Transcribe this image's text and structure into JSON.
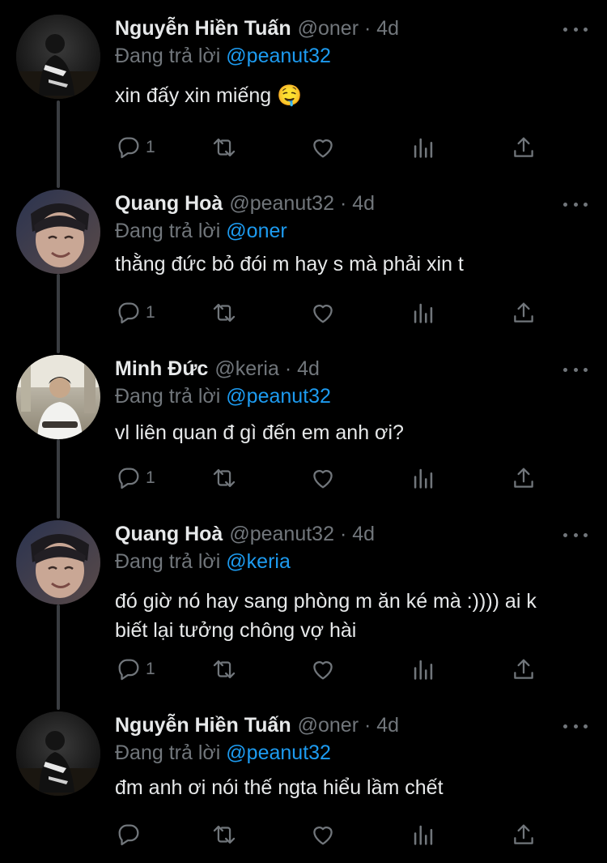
{
  "tweets": [
    {
      "name": "Nguyễn Hiền Tuấn",
      "meta": "@oner · 4d",
      "replying_prefix": "Đang trả lời",
      "replying_to": "@peanut32",
      "text": "xin đấy xin miếng 🤤",
      "reply_count": "1",
      "avatar": "avatar-photo-dark-figure"
    },
    {
      "name": "Quang Hoà",
      "meta": "@peanut32 · 4d",
      "replying_prefix": "Đang trả lời",
      "replying_to": "@oner",
      "text": "thằng đức bỏ đói m hay s mà phải xin t",
      "reply_count": "1",
      "avatar": "avatar-photo-smiling-boy"
    },
    {
      "name": "Minh Đức",
      "meta": "@keria · 4d",
      "replying_prefix": "Đang trả lời",
      "replying_to": "@peanut32",
      "text": "vl liên quan đ gì đến em anh ơi?",
      "reply_count": "1",
      "avatar": "avatar-photo-seated-boy"
    },
    {
      "name": "Quang Hoà",
      "meta": "@peanut32 · 4d",
      "replying_prefix": "Đang trả lời",
      "replying_to": "@keria",
      "text": "đó giờ nó hay sang phòng m ăn ké mà :)))) ai k\nbiết lại tưởng chông vợ hài",
      "reply_count": "1",
      "avatar": "avatar-photo-smiling-boy"
    },
    {
      "name": "Nguyễn Hiền Tuấn",
      "meta": "@oner · 4d",
      "replying_prefix": "Đang trả lời",
      "replying_to": "@peanut32",
      "text": "đm anh ơi nói thế ngta hiểu lầm chết",
      "reply_count": "",
      "avatar": "avatar-photo-dark-figure"
    }
  ],
  "colors": {
    "background": "#000000",
    "text_primary": "#e7e9ea",
    "text_secondary": "#71767b",
    "mention": "#1d9bf0",
    "thread_line": "#3a3d41"
  },
  "icons": [
    "reply-icon",
    "retweet-icon",
    "like-icon",
    "views-icon",
    "share-icon",
    "more-icon"
  ]
}
